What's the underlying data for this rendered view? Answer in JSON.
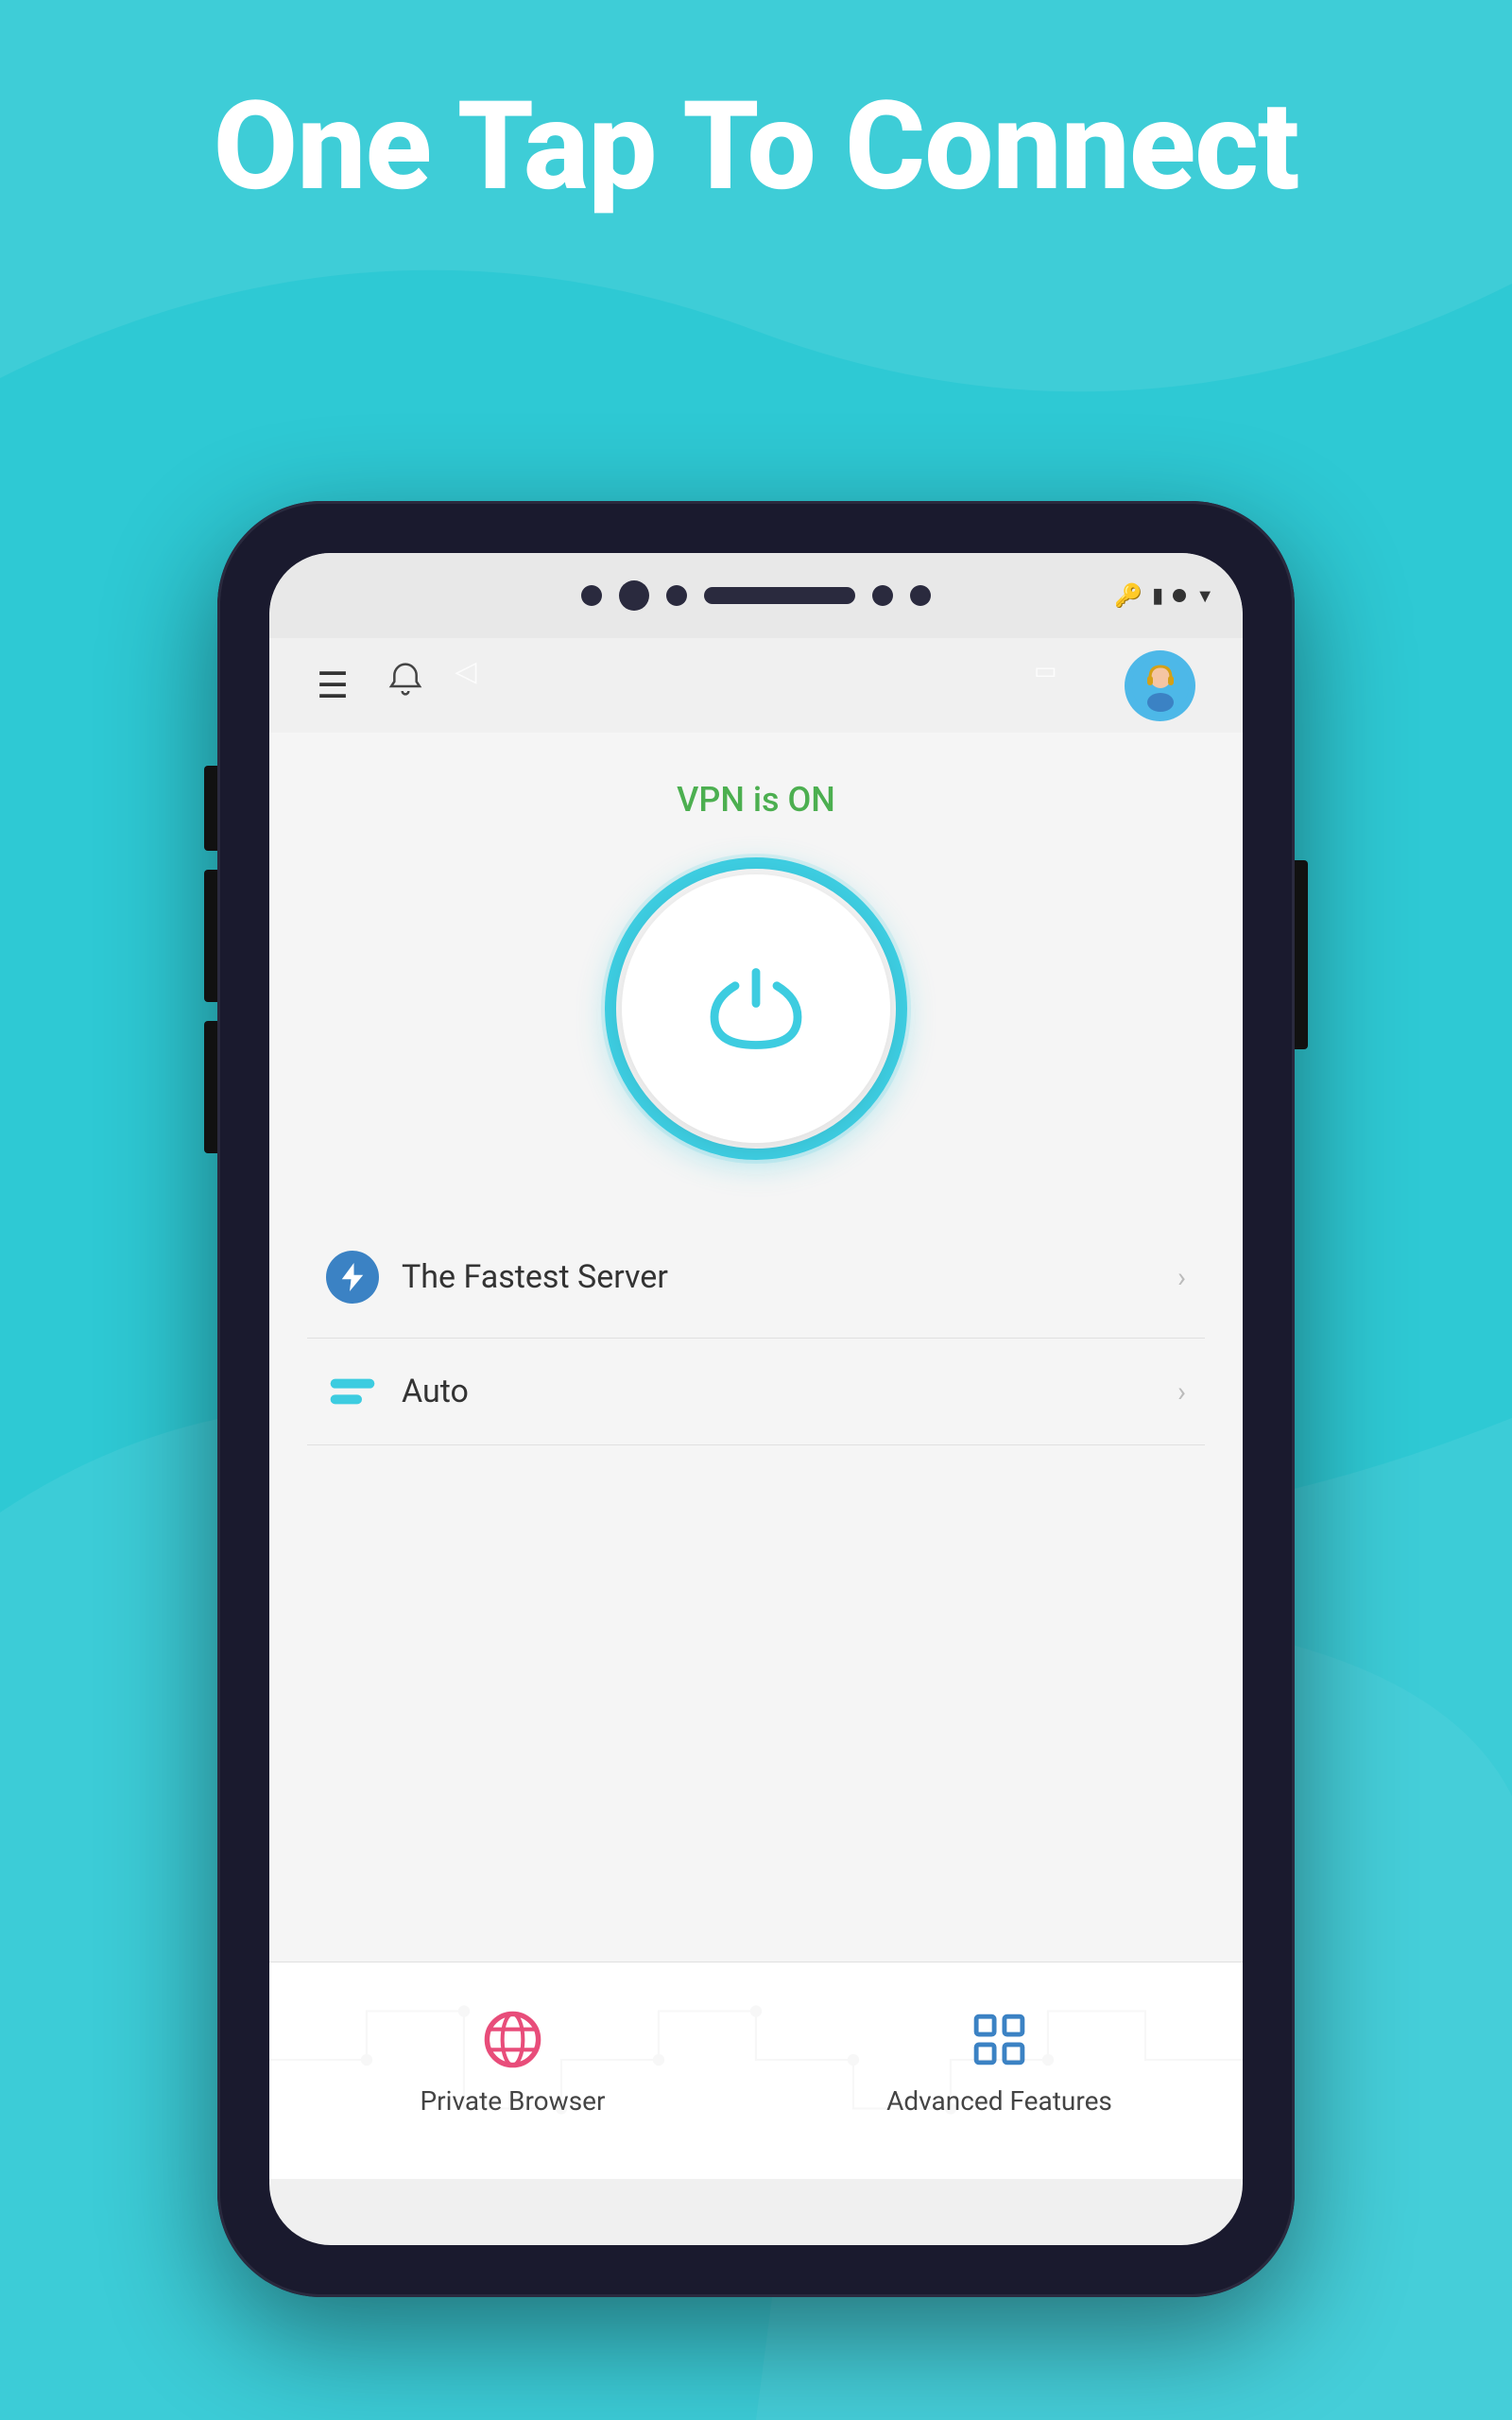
{
  "hero": {
    "title": "One Tap To Connect"
  },
  "phone": {
    "status_bar": {
      "vpn_icon": "🔑",
      "signal_icon": "▮",
      "dot": "●",
      "wifi": "▼"
    },
    "app_bar": {
      "hamburger_label": "☰",
      "bell_label": "🔔"
    },
    "vpn_status": "VPN is ON",
    "server_row": {
      "label": "The Fastest Server",
      "chevron": ">"
    },
    "protocol_row": {
      "label": "Auto",
      "chevron": ">"
    },
    "bottom_nav": {
      "items": [
        {
          "label": "Private Browser",
          "icon": "globe"
        },
        {
          "label": "Advanced Features",
          "icon": "grid"
        }
      ]
    }
  },
  "colors": {
    "background": "#2ec9d4",
    "vpn_on": "#4caf50",
    "power_ring": "#3dcce0",
    "server_icon": "#3b82c4",
    "globe_icon": "#e84d7a",
    "grid_icon": "#3b82c4",
    "white": "#ffffff"
  }
}
